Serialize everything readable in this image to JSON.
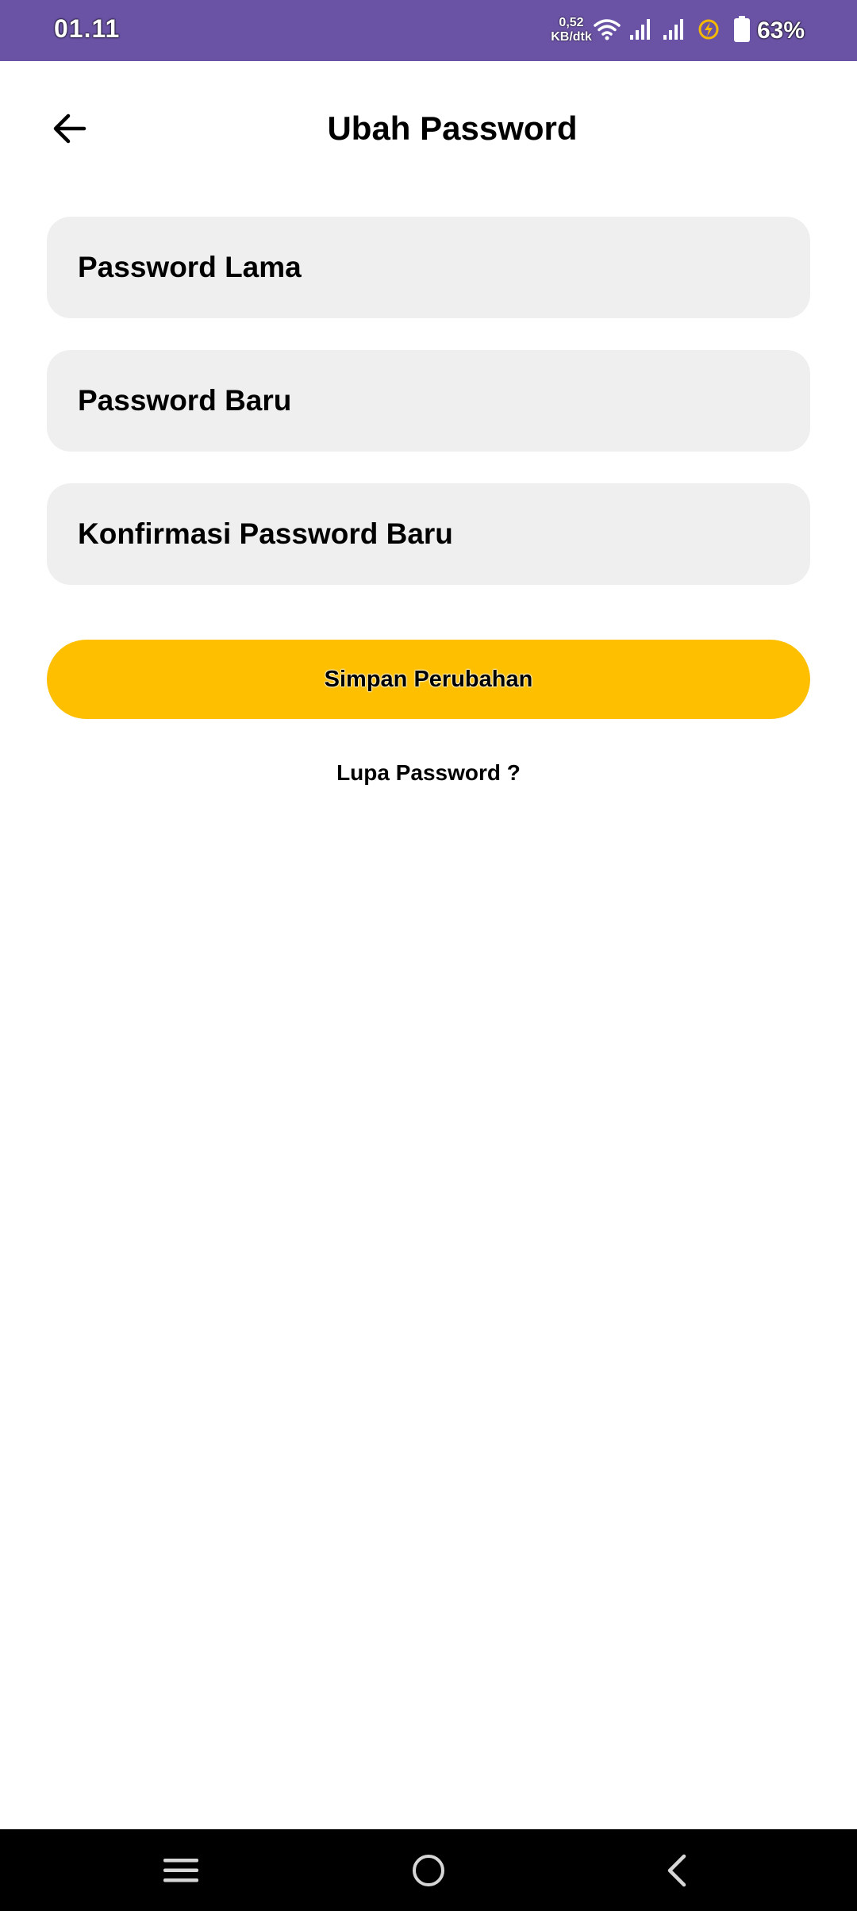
{
  "status_bar": {
    "time": "01.11",
    "net_speed_value": "0,52",
    "net_speed_unit": "KB/dtk",
    "battery_percent": "63%",
    "icons": [
      "wifi-icon",
      "signal-icon",
      "signal-icon",
      "battery-saver-icon",
      "battery-icon"
    ]
  },
  "header": {
    "title": "Ubah Password",
    "back_icon": "arrow-left-icon"
  },
  "form": {
    "old_password_placeholder": "Password Lama",
    "new_password_placeholder": "Password Baru",
    "confirm_password_placeholder": "Konfirmasi Password Baru",
    "save_label": "Simpan Perubahan",
    "forgot_label": "Lupa Password ?"
  },
  "nav_bar": {
    "icons": [
      "menu-icon",
      "home-icon",
      "back-chevron-icon"
    ]
  },
  "colors": {
    "status_bar": "#6a52a5",
    "field_bg": "#efefef",
    "accent": "#fdbf00",
    "nav_bar": "#000000"
  }
}
